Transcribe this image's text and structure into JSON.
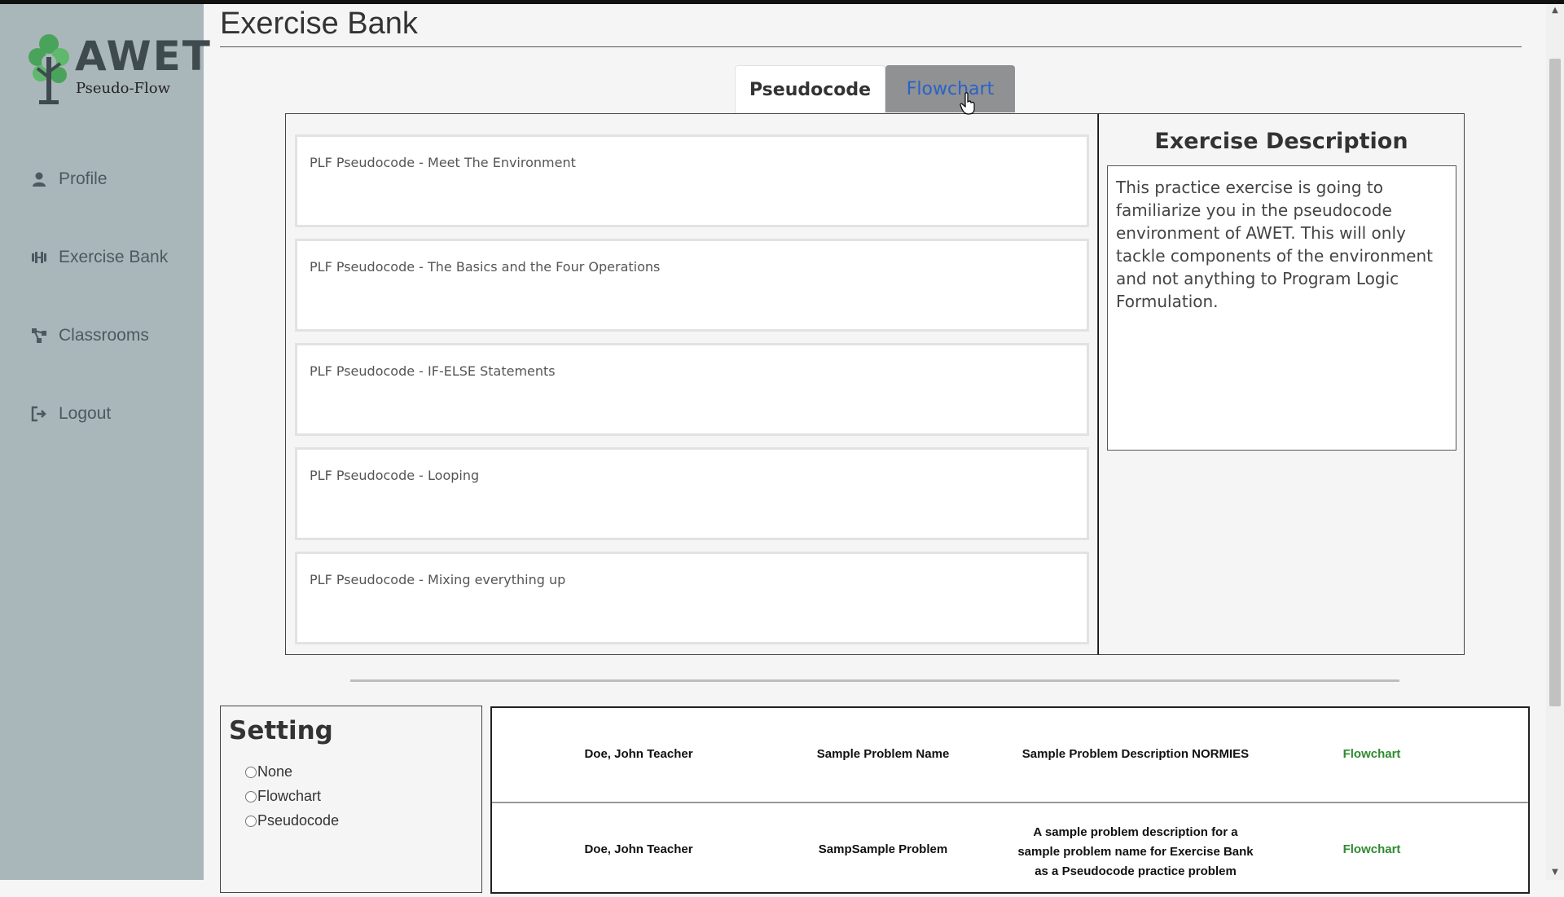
{
  "app": {
    "brand": "AWET",
    "brand_sub": "Pseudo-Flow"
  },
  "sidebar": {
    "items": [
      {
        "label": "Profile",
        "icon": "user-icon"
      },
      {
        "label": "Exercise Bank",
        "icon": "dumbbell-icon"
      },
      {
        "label": "Classrooms",
        "icon": "network-icon"
      },
      {
        "label": "Logout",
        "icon": "logout-icon"
      }
    ]
  },
  "page": {
    "title": "Exercise Bank"
  },
  "tabs": [
    {
      "label": "Pseudocode",
      "active": true
    },
    {
      "label": "Flowchart",
      "active": false,
      "hovered": true
    }
  ],
  "exercises": [
    "PLF Pseudocode - Meet The Environment",
    "PLF Pseudocode - The Basics and the Four Operations",
    "PLF Pseudocode - IF-ELSE Statements",
    "PLF Pseudocode - Looping",
    "PLF Pseudocode - Mixing everything up"
  ],
  "description": {
    "title": "Exercise Description",
    "text": "This practice exercise is going to familiarize you in the pseudocode environment of AWET. This will only tackle components of the environment and not anything to Program Logic Formulation."
  },
  "setting": {
    "title": "Setting",
    "options": [
      "None",
      "Flowchart",
      "Pseudocode"
    ]
  },
  "problems": [
    {
      "author": "Doe, John Teacher",
      "name": "Sample Problem Name",
      "description": "Sample Problem Description NORMIES",
      "type": "Flowchart"
    },
    {
      "author": "Doe, John Teacher",
      "name": "SampSample Problem",
      "description": "A sample problem description for a sample problem name for Exercise Bank as a Pseudocode practice problem",
      "type": "Flowchart"
    }
  ],
  "colors": {
    "sidebar_bg": "#aab7ba",
    "tab_hover_bg": "#8f9192",
    "tab_hover_text": "#2a62c9",
    "link_green": "#2e8b2e",
    "logo_green": "#4aa35a"
  }
}
